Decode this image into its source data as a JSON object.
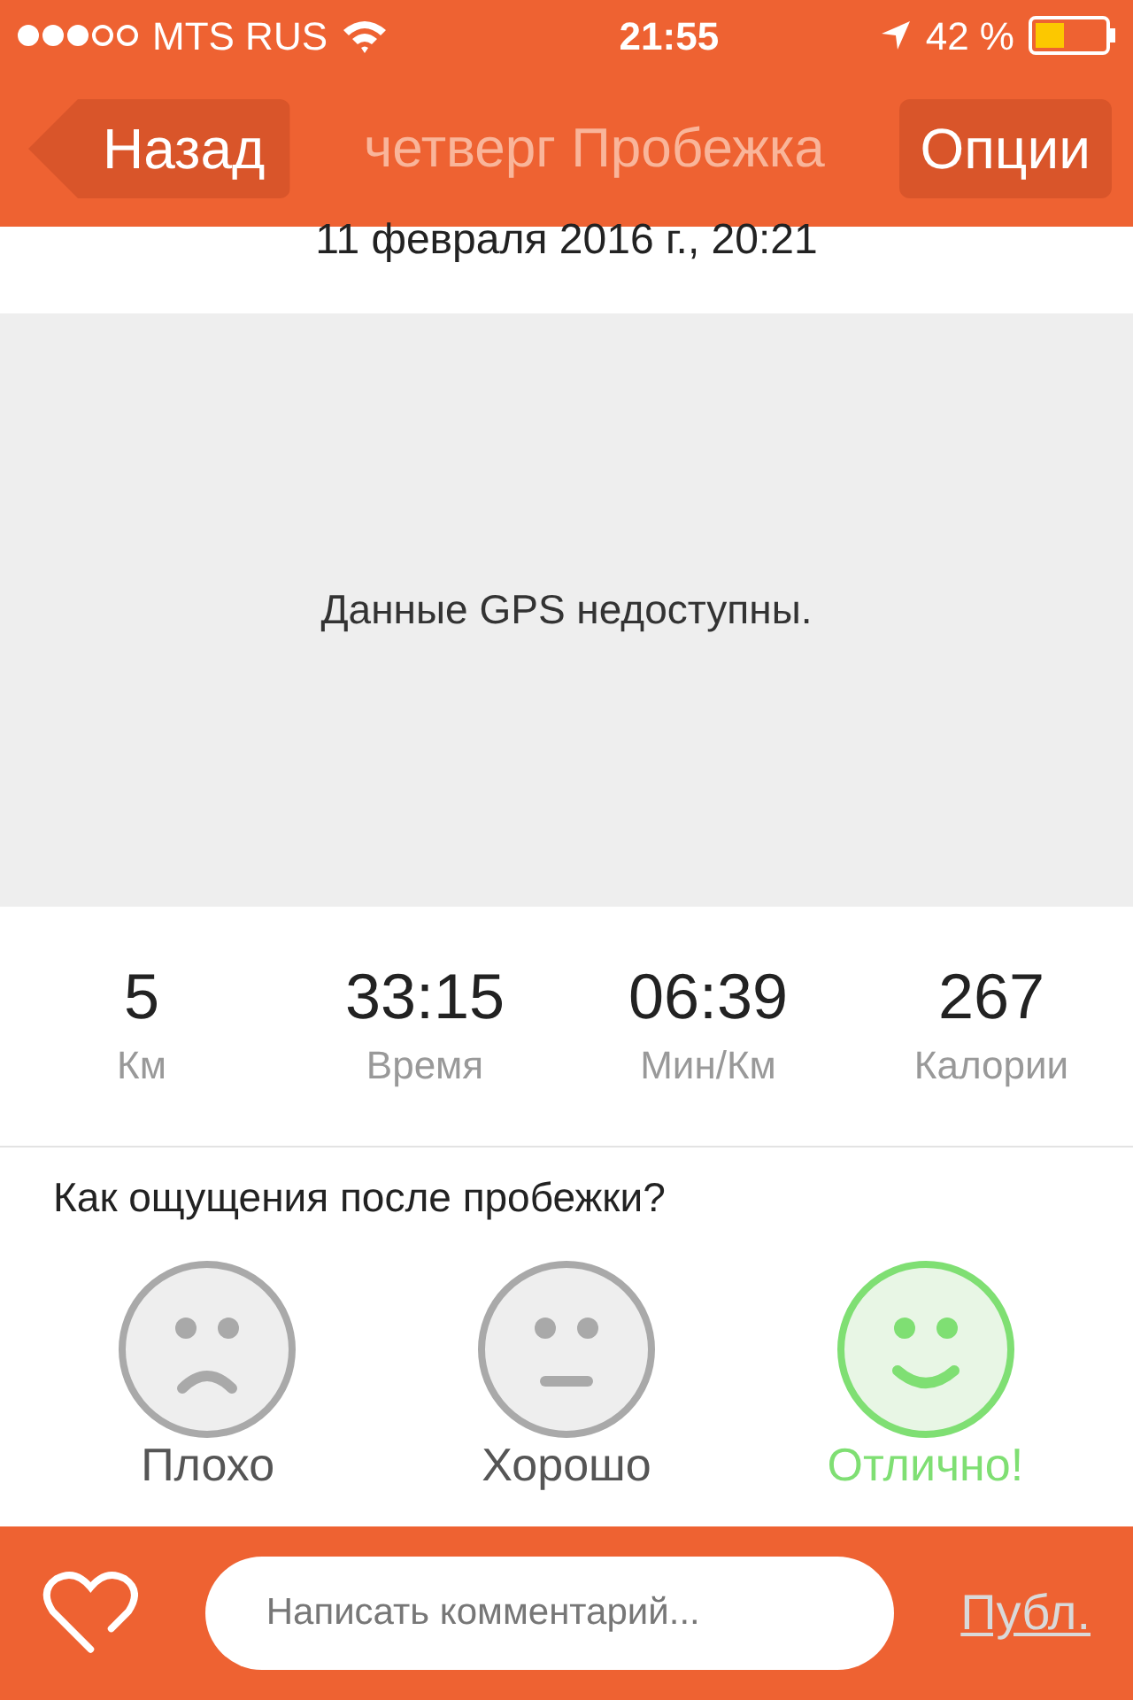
{
  "status_bar": {
    "carrier": "MTS RUS",
    "time": "21:55",
    "battery": "42 %"
  },
  "nav": {
    "back": "Назад",
    "title": "четверг Пробежка",
    "options": "Опции"
  },
  "date": "11 февраля 2016 г., 20:21",
  "map": {
    "message": "Данные GPS недоступны."
  },
  "stats": [
    {
      "value": "5",
      "label": "Км"
    },
    {
      "value": "33:15",
      "label": "Время"
    },
    {
      "value": "06:39",
      "label": "Мин/Км"
    },
    {
      "value": "267",
      "label": "Калории"
    }
  ],
  "feeling": {
    "question": "Как ощущения после пробежки?",
    "moods": [
      {
        "kind": "sad",
        "label": "Плохо",
        "selected": false
      },
      {
        "kind": "neutral",
        "label": "Хорошо",
        "selected": false
      },
      {
        "kind": "happy",
        "label": "Отлично!",
        "selected": true
      }
    ]
  },
  "comment_bar": {
    "placeholder": "Написать комментарий...",
    "publish": "Публ."
  }
}
